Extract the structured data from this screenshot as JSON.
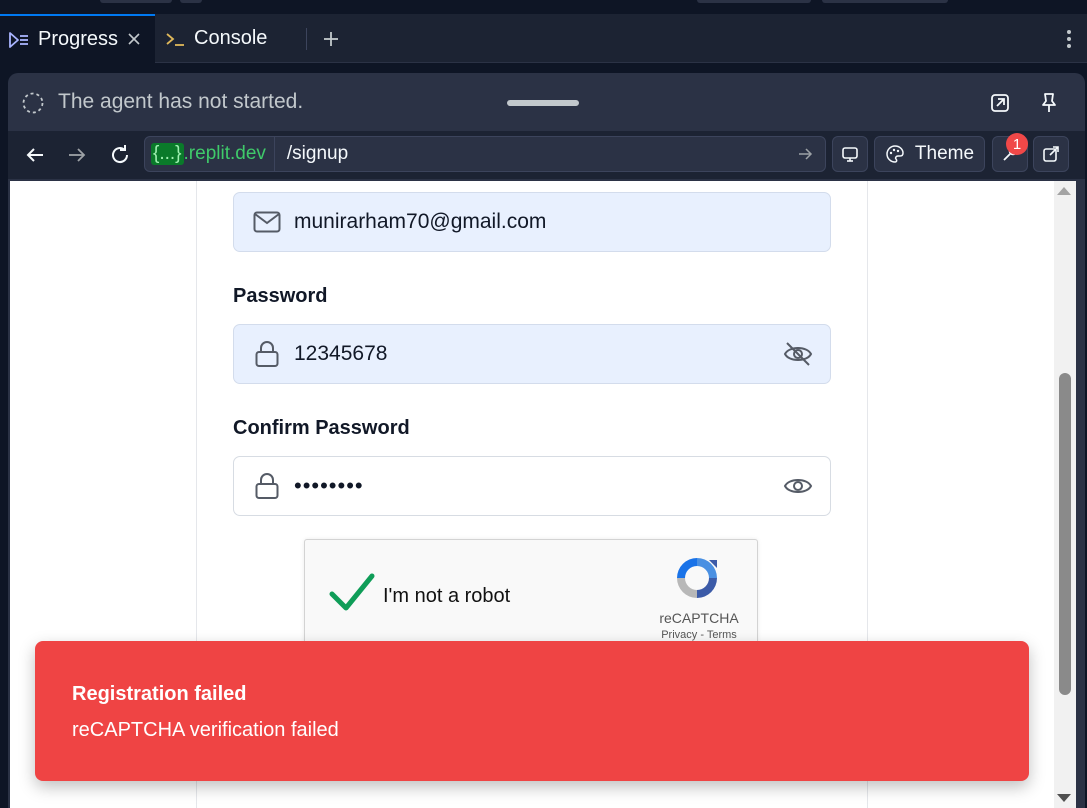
{
  "tabs": [
    {
      "label": "Progress",
      "icon": "progress-icon",
      "active": true
    },
    {
      "label": "Console",
      "icon": "terminal-icon",
      "active": false
    }
  ],
  "agent_status": "The agent has not started.",
  "url": {
    "host_braces": "{...}",
    "host_domain": ".replit.dev",
    "path": "/signup"
  },
  "toolbar": {
    "theme_label": "Theme",
    "devtools_badge": "1"
  },
  "form": {
    "email_value": "munirarham70@gmail.com",
    "password_label": "Password",
    "password_value": "12345678",
    "confirm_label": "Confirm Password",
    "confirm_value": "••••••••"
  },
  "captcha": {
    "label": "I'm not a robot",
    "brand": "reCAPTCHA",
    "privacy": "Privacy - Terms"
  },
  "toast": {
    "title": "Registration failed",
    "description": "reCAPTCHA verification failed"
  },
  "colors": {
    "accent": "#0079f2",
    "error": "#ef4444",
    "success": "#0f9d58"
  }
}
